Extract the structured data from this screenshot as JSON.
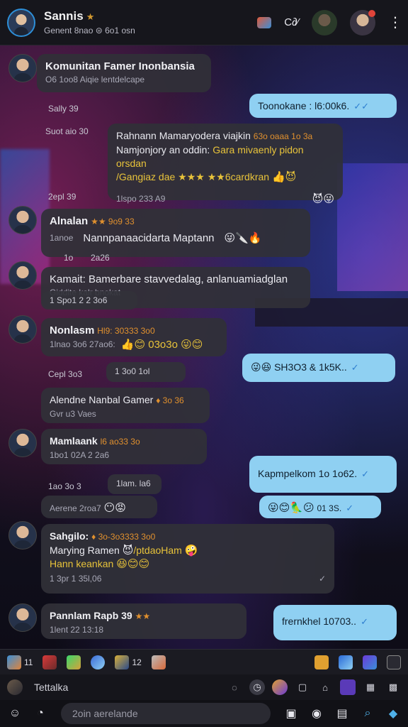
{
  "header": {
    "title": "Sannis",
    "star": "★",
    "subtitle": "Genent 8nao ⊜ 6o1 osn",
    "call_label": "C∂⁄",
    "more": "⋮"
  },
  "messages": {
    "m1": {
      "name": "Komunitan Famer Inonbansia",
      "sub": "O6 1oo8 Aiqie lentdelcape"
    },
    "m2": {
      "text": "Toonokane : l6:00k6.",
      "check": "✓✓"
    },
    "stamp1": "Sally 39",
    "stamp2": "Suot aio 30",
    "m3": {
      "line1": "Rahnann Mamaryodera viajkin",
      "line1b": "63o oaaa 1o 3a",
      "line2": "Namjonjory an oddin:",
      "line2b": "Gara mivaenly pidon orsdan",
      "line3": "/Gangiaz dae ★★★ ★★6cardkran",
      "emojis1": "👍😈",
      "time": "1lspo 233 A9",
      "emojis2": "😈😜"
    },
    "stamp3": "2epl 39",
    "m4": {
      "name": "Alnalan",
      "tag": "★★ 9o9 33",
      "sub": "1anoe",
      "text": "Nannpanaacidarta Maptann",
      "emojis": "😜🔪🔥"
    },
    "stamp4": "1o",
    "stamp5": "2a26",
    "m5": {
      "text": "Kamait: Bamerbare stavvedalag, anlanuamiadglan",
      "sub": "Giddite kalr bnokat",
      "time": "1 Spo1 2 2 3o6"
    },
    "m6": {
      "name": "Nonlasm",
      "tag": "Hl9: 30333 3o0",
      "sub": "1lnao 3o6 27ao6:",
      "emojis": "👍😊 03o3o 😜😊"
    },
    "chip1": "1 3o0 1ol",
    "stamp6": "Cepl 3o3",
    "m7": {
      "text": "😜😆 SH3O3 & 1k5K..",
      "check": "✓"
    },
    "m8": {
      "name": "Alendne Nanbal Gamer",
      "tag": "♦ 3o 36",
      "sub": "Gvr u3 Vaes"
    },
    "m9": {
      "name": "Mamlaank",
      "tag": "l6 ao33 3o",
      "sub": "1bo1 02A 2 2a6"
    },
    "stamp7": "1ao 3o 3",
    "chip2": "1lam. la6",
    "m10": {
      "text": "Kapmpelkom 1o 1o62.",
      "check": "✓"
    },
    "m11": {
      "text": "Aerene 2roa7",
      "emojis": "😶😡"
    },
    "m12": {
      "emojis": "😜😊🦜😕",
      "text": "01 3S.",
      "check": "✓"
    },
    "m13": {
      "name": "Sahgilo:",
      "tag": "♦ 3o-3o3333 3o0",
      "line1": "Marying Ramen",
      "line1b": "/ptdaoHam",
      "line2": "Hann keankan",
      "emojis1": "😈",
      "emojis2": "🤪",
      "emojis3": "😆😊😊",
      "time": "1 3pr 1 35l,06",
      "check": "✓"
    },
    "m14": {
      "name": "Pannlam Rapb 39",
      "tag": "★★",
      "sub": "1lent 22 13:18"
    },
    "m15": {
      "text": "frernkhel 10703..",
      "check": "✓"
    }
  },
  "sticker_bar": {
    "counts": [
      "11",
      "12"
    ]
  },
  "composer": {
    "label": "Tettalka"
  },
  "bottom_nav": {
    "search_placeholder": "2oin aerelande"
  },
  "colors": {
    "accent": "#2d8fd8",
    "outgoing_bubble": "#8fd0f2",
    "incoming_bubble": "#303038",
    "star": "#d49a30"
  }
}
